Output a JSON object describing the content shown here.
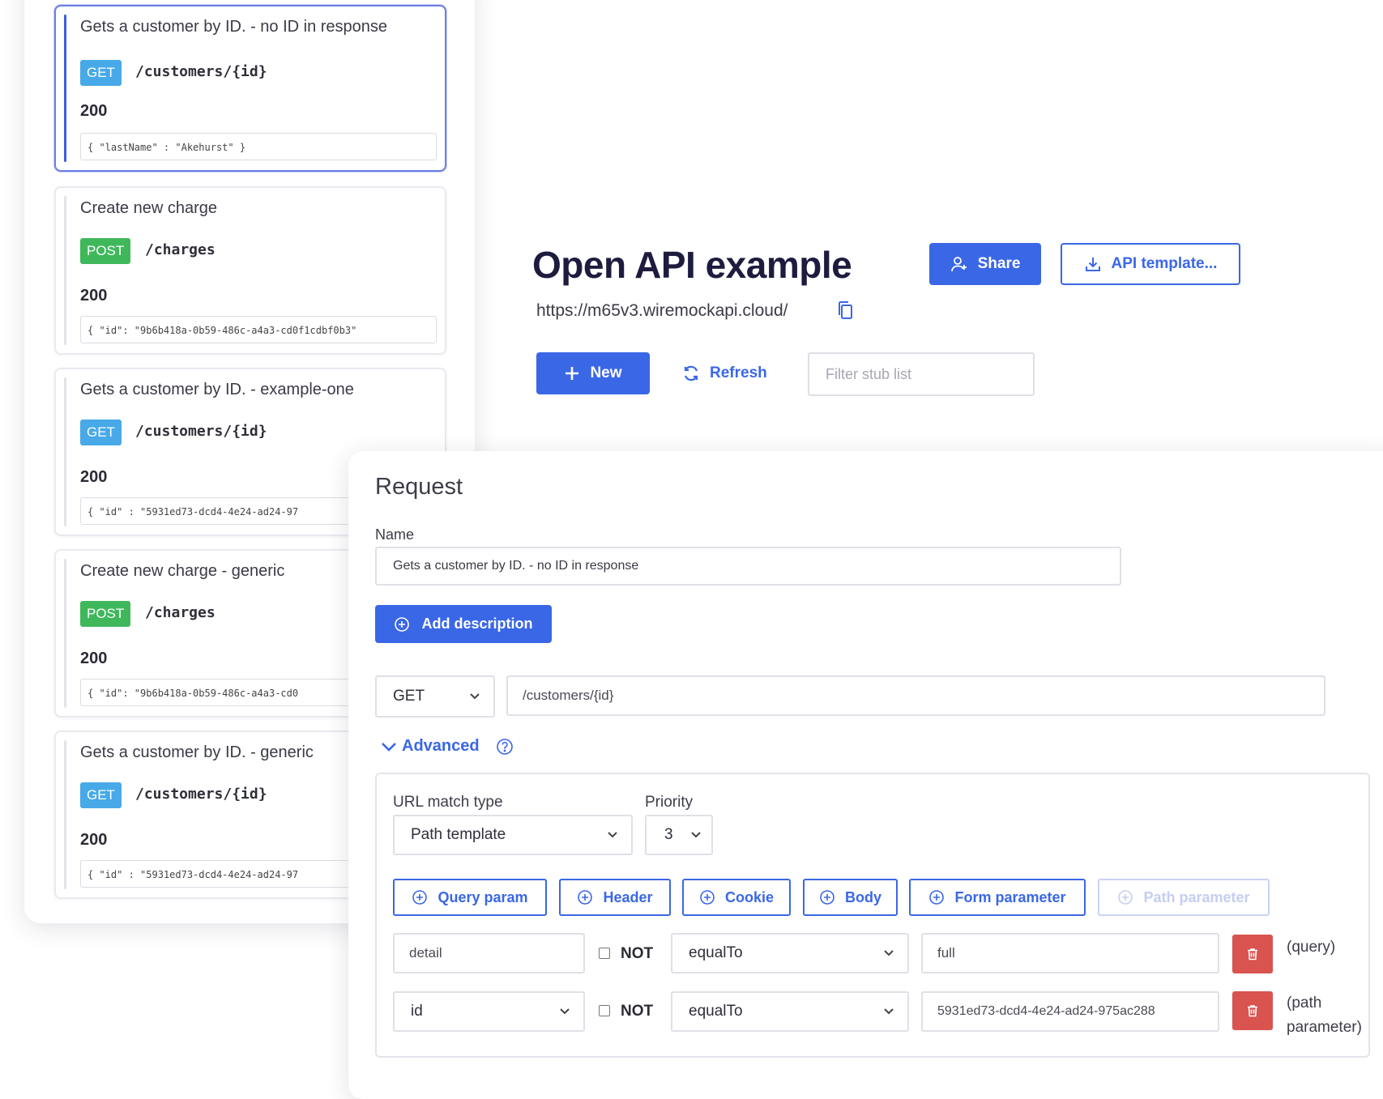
{
  "stub_list": [
    {
      "title": "Gets a customer by ID. - no ID in response",
      "method": "GET",
      "path": "/customers/{id}",
      "status": "200",
      "body": "{ \"lastName\" : \"Akehurst\" }",
      "selected": true
    },
    {
      "title": "Create new charge",
      "method": "POST",
      "path": "/charges",
      "status": "200",
      "body": "{ \"id\": \"9b6b418a-0b59-486c-a4a3-cd0f1cdbf0b3\"",
      "selected": false
    },
    {
      "title": "Gets a customer by ID. - example-one",
      "method": "GET",
      "path": "/customers/{id}",
      "status": "200",
      "body": "{ \"id\" : \"5931ed73-dcd4-4e24-ad24-97",
      "selected": false
    },
    {
      "title": "Create new charge - generic",
      "method": "POST",
      "path": "/charges",
      "status": "200",
      "body": "{ \"id\": \"9b6b418a-0b59-486c-a4a3-cd0",
      "selected": false
    },
    {
      "title": "Gets a customer by ID. - generic",
      "method": "GET",
      "path": "/customers/{id}",
      "status": "200",
      "body": "{ \"id\" : \"5931ed73-dcd4-4e24-ad24-97",
      "selected": false
    }
  ],
  "header": {
    "title": "Open API example",
    "share_label": "Share",
    "api_template_label": "API template...",
    "base_url": "https://m65v3.wiremockapi.cloud/"
  },
  "toolbar": {
    "new_label": "New",
    "refresh_label": "Refresh",
    "filter_placeholder": "Filter stub list"
  },
  "request": {
    "heading": "Request",
    "name_label": "Name",
    "name_value": "Gets a customer by ID. - no ID in response",
    "add_description_label": "Add description",
    "method": "GET",
    "url": "/customers/{id}",
    "advanced_label": "Advanced",
    "url_match_type_label": "URL match type",
    "url_match_type_value": "Path template",
    "priority_label": "Priority",
    "priority_value": "3",
    "add_buttons": {
      "query_param": "Query param",
      "header": "Header",
      "cookie": "Cookie",
      "body": "Body",
      "form_parameter": "Form parameter",
      "path_parameter": "Path parameter"
    },
    "matchers": [
      {
        "key": "detail",
        "not_label": "NOT",
        "operator": "equalTo",
        "value": "full",
        "note": "(query)"
      },
      {
        "key": "id",
        "not_label": "NOT",
        "operator": "equalTo",
        "value": "5931ed73-dcd4-4e24-ad24-975ac288",
        "note": "(path parameter)"
      }
    ]
  },
  "colors": {
    "accent": "#3a67e6",
    "get_badge": "#47a9e8",
    "post_badge": "#3fb85c",
    "delete": "#d9534f",
    "title": "#1d1c3f"
  }
}
